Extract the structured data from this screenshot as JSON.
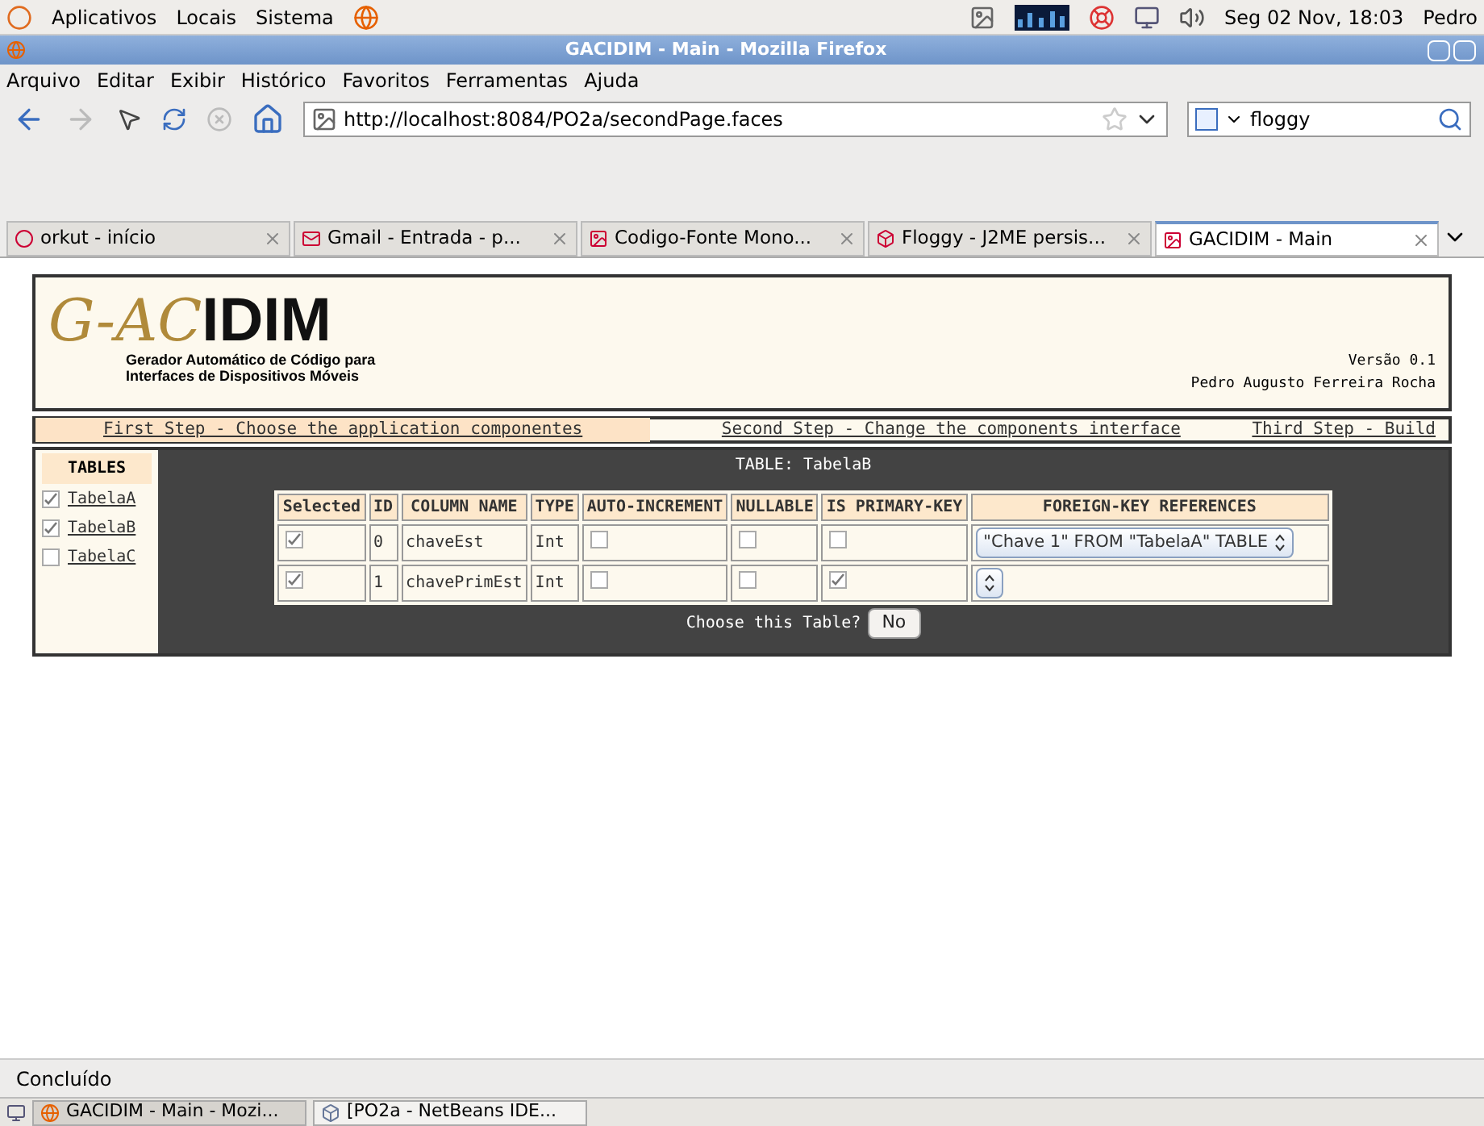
{
  "top_panel": {
    "menus": [
      "Aplicativos",
      "Locais",
      "Sistema"
    ],
    "clock": "Seg 02 Nov, 18:03",
    "user": "Pedro"
  },
  "window": {
    "title": "GACIDIM - Main - Mozilla Firefox"
  },
  "menu_bar": [
    "Arquivo",
    "Editar",
    "Exibir",
    "Histórico",
    "Favoritos",
    "Ferramentas",
    "Ajuda"
  ],
  "address_bar": {
    "value": "http://localhost:8084/PO2a/secondPage.faces"
  },
  "search": {
    "value": "floggy"
  },
  "tabs": [
    {
      "label": "orkut - início",
      "selected": false
    },
    {
      "label": "Gmail - Entrada - p...",
      "selected": false
    },
    {
      "label": "Codigo-Fonte Mono...",
      "selected": false
    },
    {
      "label": "Floggy - J2ME persis...",
      "selected": false
    },
    {
      "label": "GACIDIM - Main",
      "selected": true
    }
  ],
  "page": {
    "logo_script": "G-AC",
    "logo_block": "IDIM",
    "subtitle": [
      "Gerador Automático de Código para",
      "Interfaces de Dispositivos Móveis"
    ],
    "version": "Versão 0.1",
    "author": "Pedro Augusto Ferreira Rocha",
    "steps": [
      {
        "label": "First Step - Choose the application componentes",
        "selected": true
      },
      {
        "label": "Second Step - Change the components interface",
        "selected": false
      },
      {
        "label": "Third Step - Build",
        "selected": false
      }
    ],
    "tables_heading": "TABLES",
    "tables": [
      {
        "name": "TabelaA",
        "checked": true
      },
      {
        "name": "TabelaB",
        "checked": true
      },
      {
        "name": "TabelaC",
        "checked": false
      }
    ],
    "table_title": "TABLE: TabelaB",
    "columns": [
      "Selected",
      "ID",
      "COLUMN NAME",
      "TYPE",
      "AUTO-INCREMENT",
      "NULLABLE",
      "IS PRIMARY-KEY",
      "FOREIGN-KEY REFERENCES"
    ],
    "rows": [
      {
        "selected": true,
        "id": "0",
        "name": "chaveEst",
        "type": "Int",
        "auto_increment": false,
        "nullable": false,
        "primary_key": false,
        "fk": "\"Chave 1\" FROM \"TabelaA\" TABLE"
      },
      {
        "selected": true,
        "id": "1",
        "name": "chavePrimEst",
        "type": "Int",
        "auto_increment": false,
        "nullable": false,
        "primary_key": true
      }
    ],
    "choose_label": "Choose this Table?",
    "choose_button": "No"
  },
  "status_bar": "Concluído",
  "taskbar": [
    "GACIDIM - Main - Mozi...",
    "[PO2a - NetBeans IDE..."
  ]
}
